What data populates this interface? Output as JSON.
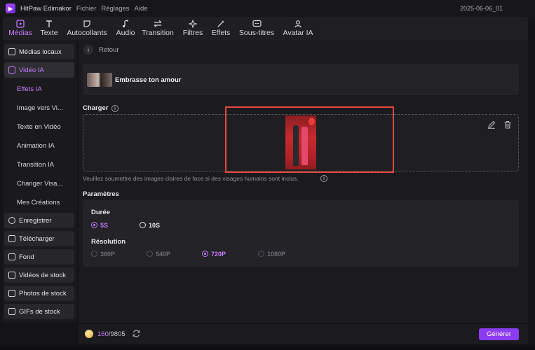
{
  "titlebar": {
    "app_name": "HitPaw Edimakor",
    "menus": [
      "Fichier",
      "Réglages",
      "Aide"
    ],
    "project_name": "2025-06-06_01"
  },
  "toolbar": {
    "tabs": [
      {
        "label": "Médias",
        "icon": "media-icon",
        "active": true
      },
      {
        "label": "Texte",
        "icon": "text-icon",
        "active": false
      },
      {
        "label": "Autocollants",
        "icon": "sticker-icon",
        "active": false
      },
      {
        "label": "Audio",
        "icon": "music-note-icon",
        "active": false
      },
      {
        "label": "Transition",
        "icon": "transition-arrows-icon",
        "active": false
      },
      {
        "label": "Filtres",
        "icon": "sparkle-icon",
        "active": false
      },
      {
        "label": "Effets",
        "icon": "magic-wand-icon",
        "active": false
      },
      {
        "label": "Sous-titres",
        "icon": "subtitles-icon",
        "active": false
      },
      {
        "label": "Avatar IA",
        "icon": "avatar-icon",
        "active": false
      }
    ]
  },
  "sidebar": {
    "items": [
      {
        "label": "Médias locaux",
        "icon": "folder-icon"
      },
      {
        "label": "Vidéo IA",
        "icon": "ai-video-icon",
        "active": true
      },
      {
        "label": "Enregistrer",
        "icon": "record-icon"
      },
      {
        "label": "Télécharger",
        "icon": "download-icon"
      },
      {
        "label": "Fond",
        "icon": "background-icon"
      },
      {
        "label": "Vidéos de stock",
        "icon": "stock-video-icon"
      },
      {
        "label": "Photos de stock",
        "icon": "stock-photo-icon"
      },
      {
        "label": "GIFs de stock",
        "icon": "gif-icon"
      }
    ],
    "sub_items": [
      {
        "label": "Effets IA",
        "active": true
      },
      {
        "label": "Image vers Vi..."
      },
      {
        "label": "Texte en Vidéo"
      },
      {
        "label": "Animation IA"
      },
      {
        "label": "Transition IA"
      },
      {
        "label": "Changer Visa..."
      },
      {
        "label": "Mes Créations"
      }
    ]
  },
  "main": {
    "back_label": "Retour",
    "template_title": "Embrasse ton amour",
    "upload": {
      "label": "Charger",
      "hint": "Veuillez soumettre des images claires de face si des visages humains sont inclus."
    },
    "params": {
      "label": "Paramètres",
      "duration_label": "Durée",
      "durations": [
        {
          "value": "5S",
          "selected": true
        },
        {
          "value": "10S",
          "selected": false
        }
      ],
      "resolution_label": "Résolution",
      "resolutions": [
        {
          "value": "360P",
          "selected": false
        },
        {
          "value": "540P",
          "selected": false
        },
        {
          "value": "720P",
          "selected": true
        },
        {
          "value": "1080P",
          "selected": false
        }
      ]
    }
  },
  "footer": {
    "credits_used": "160",
    "credits_total": "/9805",
    "generate_label": "Générer"
  },
  "colors": {
    "accent": "#c77dff",
    "button": "#8b3cf0",
    "highlight": "#e5483c"
  }
}
